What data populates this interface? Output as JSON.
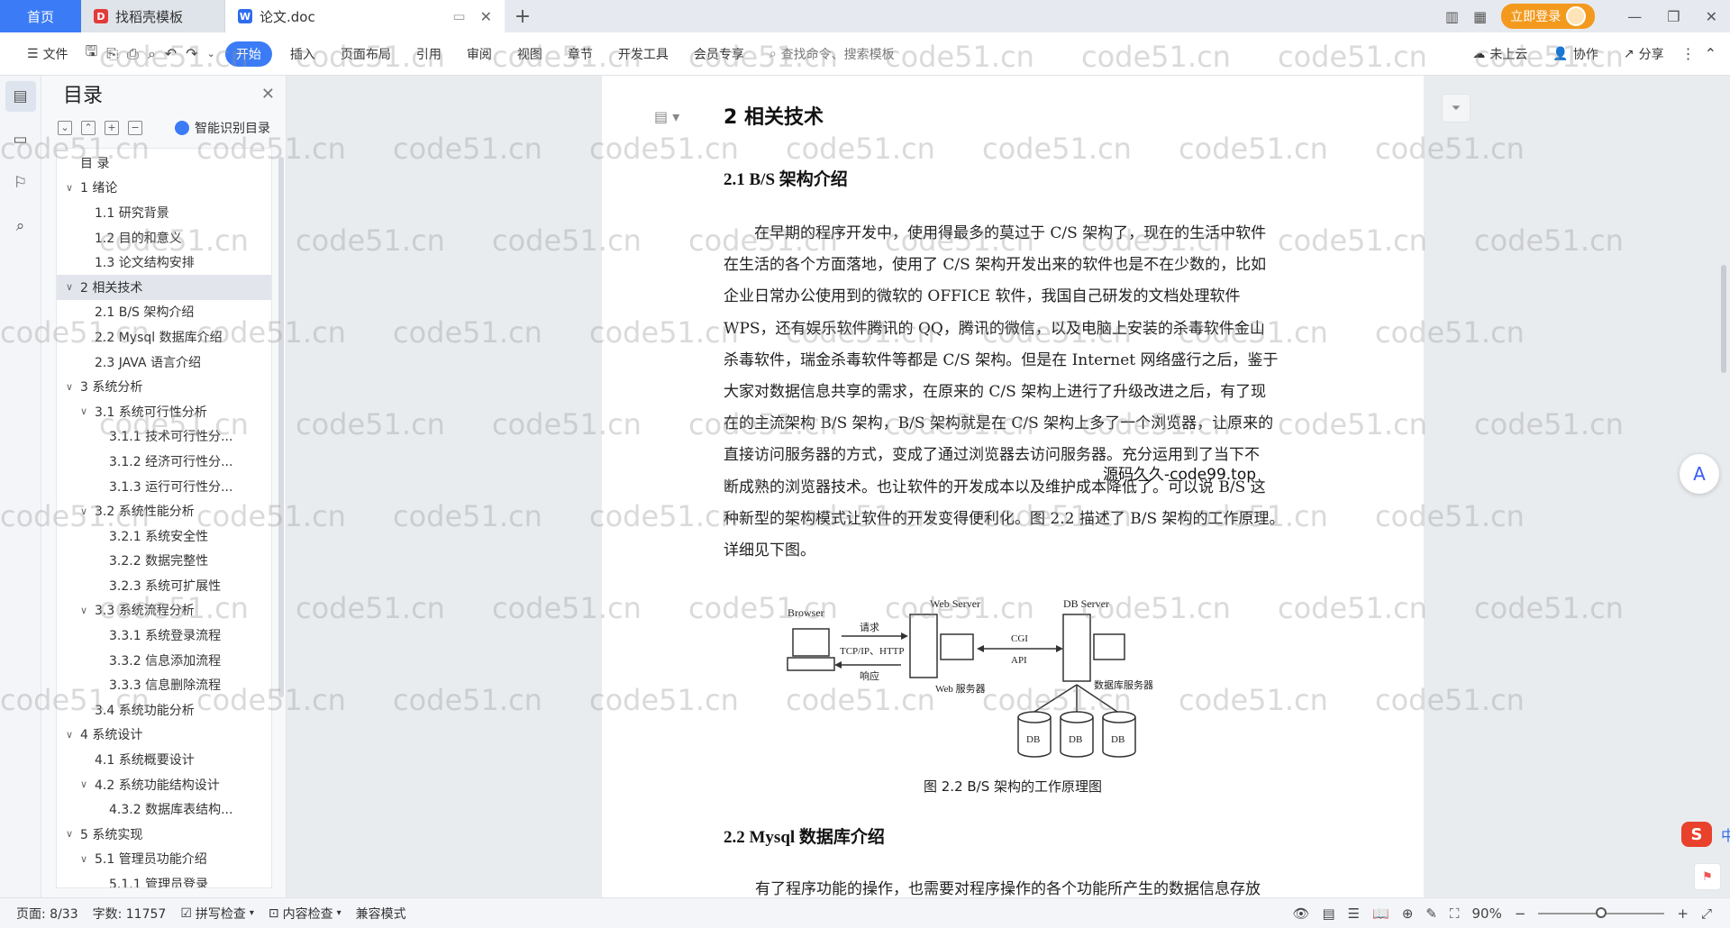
{
  "titlebar": {
    "tabs": [
      {
        "label": "首页"
      },
      {
        "label": "找稻壳模板"
      },
      {
        "label": "论文.doc"
      }
    ],
    "login_label": "立即登录"
  },
  "ribbon": {
    "file": "文件",
    "items": [
      "开始",
      "插入",
      "页面布局",
      "引用",
      "审阅",
      "视图",
      "章节",
      "开发工具",
      "会员专享"
    ],
    "search_placeholder": "查找命令、搜索模板",
    "cloud": "未上云",
    "collab": "协作",
    "share": "分享"
  },
  "toc": {
    "title": "目录",
    "smart_label": "智能识别目录",
    "items": [
      {
        "label": "目  录",
        "indent": 0,
        "chev": ""
      },
      {
        "label": "1  绪论",
        "indent": 0,
        "chev": "v"
      },
      {
        "label": "1.1  研究背景",
        "indent": 1,
        "chev": ""
      },
      {
        "label": "1.2 目的和意义",
        "indent": 1,
        "chev": ""
      },
      {
        "label": "1.3  论文结构安排",
        "indent": 1,
        "chev": ""
      },
      {
        "label": "2  相关技术",
        "indent": 0,
        "chev": "v",
        "selected": true
      },
      {
        "label": "2.1 B/S 架构介绍",
        "indent": 1,
        "chev": ""
      },
      {
        "label": "2.2 Mysql 数据库介绍",
        "indent": 1,
        "chev": ""
      },
      {
        "label": "2.3 JAVA 语言介绍",
        "indent": 1,
        "chev": ""
      },
      {
        "label": "3  系统分析",
        "indent": 0,
        "chev": "v"
      },
      {
        "label": "3.1 系统可行性分析",
        "indent": 1,
        "chev": "v"
      },
      {
        "label": "3.1.1  技术可行性分...",
        "indent": 2,
        "chev": ""
      },
      {
        "label": "3.1.2  经济可行性分...",
        "indent": 2,
        "chev": ""
      },
      {
        "label": "3.1.3  运行可行性分...",
        "indent": 2,
        "chev": ""
      },
      {
        "label": "3.2 系统性能分析",
        "indent": 1,
        "chev": "v"
      },
      {
        "label": "3.2.1  系统安全性",
        "indent": 2,
        "chev": ""
      },
      {
        "label": "3.2.2  数据完整性",
        "indent": 2,
        "chev": ""
      },
      {
        "label": "3.2.3 系统可扩展性",
        "indent": 2,
        "chev": ""
      },
      {
        "label": "3.3 系统流程分析",
        "indent": 1,
        "chev": "v"
      },
      {
        "label": "3.3.1 系统登录流程",
        "indent": 2,
        "chev": ""
      },
      {
        "label": "3.3.2 信息添加流程",
        "indent": 2,
        "chev": ""
      },
      {
        "label": "3.3.3 信息删除流程",
        "indent": 2,
        "chev": ""
      },
      {
        "label": "3.4 系统功能分析",
        "indent": 1,
        "chev": ""
      },
      {
        "label": "4  系统设计",
        "indent": 0,
        "chev": "v"
      },
      {
        "label": "4.1 系统概要设计",
        "indent": 1,
        "chev": ""
      },
      {
        "label": "4.2 系统功能结构设计",
        "indent": 1,
        "chev": "v"
      },
      {
        "label": "4.3.2  数据库表结构...",
        "indent": 2,
        "chev": ""
      },
      {
        "label": "5  系统实现",
        "indent": 0,
        "chev": "v"
      },
      {
        "label": "5.1 管理员功能介绍",
        "indent": 1,
        "chev": "v"
      },
      {
        "label": "5.1.1 管理员登录",
        "indent": 2,
        "chev": ""
      }
    ]
  },
  "document": {
    "heading1": "2  相关技术",
    "heading2a": "2.1 B/S 架构介绍",
    "para_lines": [
      "　　在早期的程序开发中，使用得最多的莫过于 C/S 架构了，现在的生活中软件",
      "在生活的各个方面落地，使用了 C/S 架构开发出来的软件也是不在少数的，比如",
      "企业日常办公使用到的微软的 OFFICE 软件，我国自己研发的文档处理软件",
      "WPS，还有娱乐软件腾讯的 QQ，腾讯的微信，以及电脑上安装的杀毒软件金山",
      "杀毒软件，瑞金杀毒软件等都是 C/S 架构。但是在 Internet 网络盛行之后，鉴于",
      "大家对数据信息共享的需求，在原来的 C/S 架构上进行了升级改进之后，有了现",
      "在的主流架构 B/S 架构，B/S 架构就是在 C/S 架构上多了一个浏览器，让原来的",
      "直接访问服务器的方式，变成了通过浏览器去访问服务器。充分运用到了当下不",
      "断成熟的浏览器技术。也让软件的开发成本以及维护成本降低了。可以说 B/S 这",
      "种新型的架构模式让软件的开发变得便利化。图 2.2 描述了 B/S 架构的工作原理。",
      "详细见下图。"
    ],
    "overlay_text": "源码久久-code99.top",
    "diagram": {
      "browser": "Browser",
      "web_server": "Web Server",
      "db_server": "DB Server",
      "request": "请求",
      "protocol": "TCP/IP、HTTP",
      "response": "响应",
      "cgi": "CGI",
      "api": "API",
      "web_label": "Web 服务器",
      "db_label": "数据库服务器",
      "db": "DB"
    },
    "caption": "图 2.2 B/S 架构的工作原理图",
    "heading2b": "2.2 Mysql 数据库介绍",
    "para2": "有了程序功能的操作，也需要对程序操作的各个功能所产生的数据信息存放"
  },
  "watermark": "code51.cn",
  "ime": {
    "lang": "中"
  },
  "statusbar": {
    "page": "页面: 8/33",
    "words": "字数: 11757",
    "spell": "拼写检查",
    "content": "内容检查",
    "compat": "兼容模式",
    "zoom": "90%",
    "zoom_level": 0.5
  }
}
